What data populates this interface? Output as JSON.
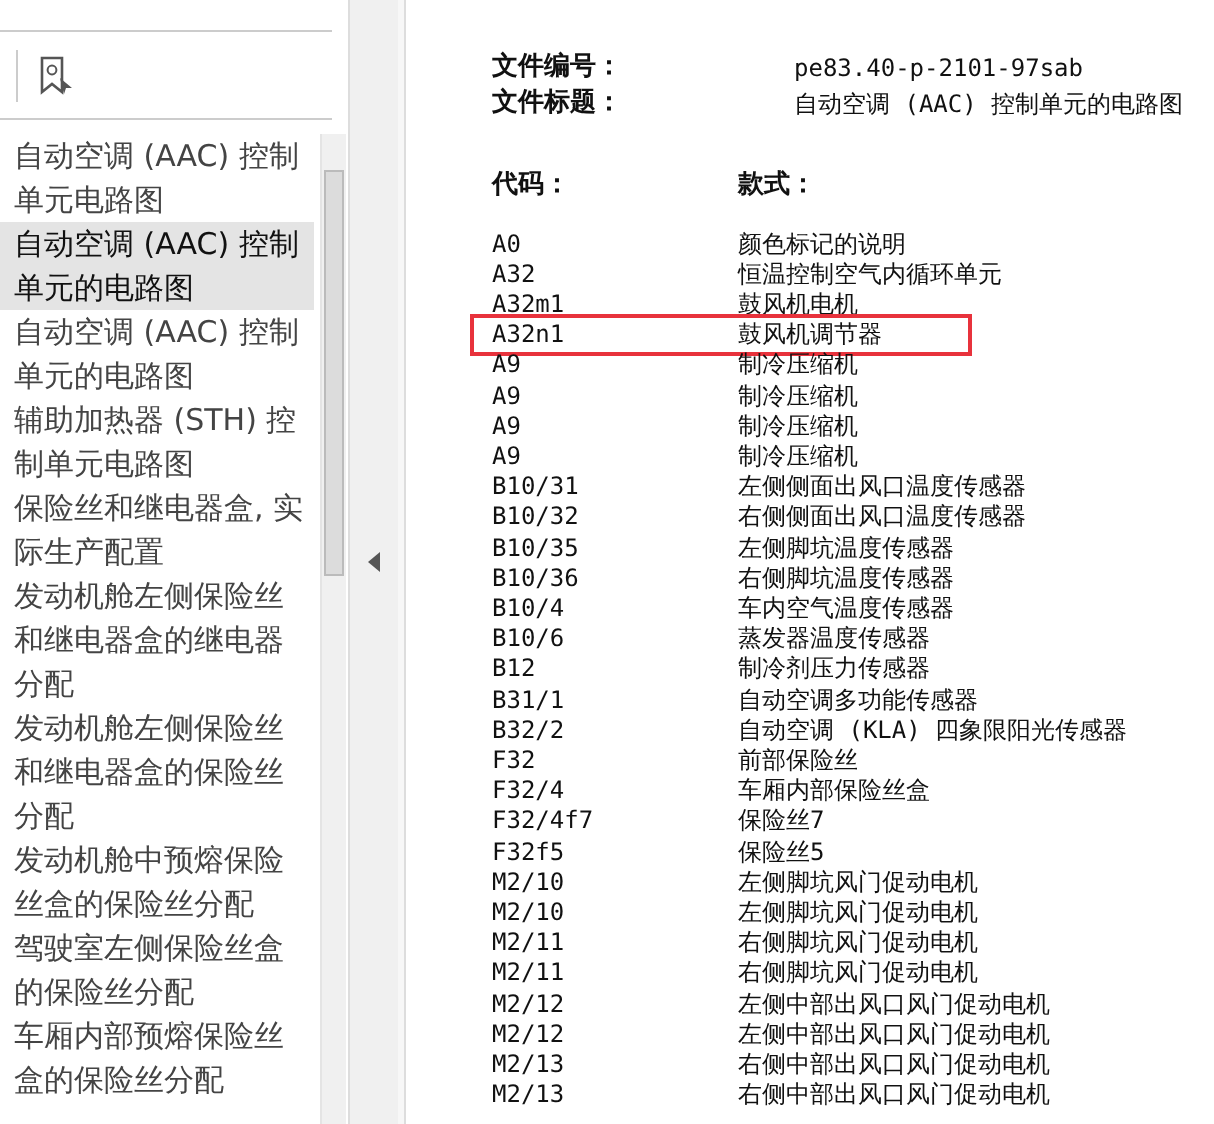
{
  "sidebar": {
    "items": [
      {
        "label": "自动空调 (AAC) 控制单元电路图",
        "selected": false
      },
      {
        "label": "自动空调 (AAC) 控制单元的电路图",
        "selected": true
      },
      {
        "label": "自动空调 (AAC) 控制单元的电路图",
        "selected": false
      },
      {
        "label": "辅助加热器 (STH) 控制单元电路图",
        "selected": false
      },
      {
        "label": "保险丝和继电器盒, 实际生产配置",
        "selected": false
      },
      {
        "label": "发动机舱左侧保险丝和继电器盒的继电器分配",
        "selected": false
      },
      {
        "label": "发动机舱左侧保险丝和继电器盒的保险丝分配",
        "selected": false
      },
      {
        "label": "发动机舱中预熔保险丝盒的保险丝分配",
        "selected": false
      },
      {
        "label": "驾驶室左侧保险丝盒的保险丝分配",
        "selected": false
      },
      {
        "label": "车厢内部预熔保险丝盒的保险丝分配",
        "selected": false
      }
    ]
  },
  "document": {
    "fields": [
      {
        "label": "文件编号：",
        "value": "pe83.40-p-2101-97sab"
      },
      {
        "label": "文件标题：",
        "value": "自动空调 (AAC) 控制单元的电路图"
      }
    ],
    "columns": [
      "代码：",
      "款式："
    ],
    "rows": [
      {
        "code": "A0",
        "name": "颜色标记的说明",
        "highlighted": false
      },
      {
        "code": "A32",
        "name": "恒温控制空气内循环单元",
        "highlighted": false
      },
      {
        "code": "A32m1",
        "name": "鼓风机电机",
        "highlighted": false
      },
      {
        "code": "A32n1",
        "name": "鼓风机调节器",
        "highlighted": true
      },
      {
        "code": "A9",
        "name": "制冷压缩机",
        "highlighted": false
      },
      {
        "code": "A9",
        "name": "制冷压缩机",
        "highlighted": false
      },
      {
        "code": "A9",
        "name": "制冷压缩机",
        "highlighted": false
      },
      {
        "code": "A9",
        "name": "制冷压缩机",
        "highlighted": false
      },
      {
        "code": "B10/31",
        "name": "左侧侧面出风口温度传感器",
        "highlighted": false
      },
      {
        "code": "B10/32",
        "name": "右侧侧面出风口温度传感器",
        "highlighted": false
      },
      {
        "code": "B10/35",
        "name": "左侧脚坑温度传感器",
        "highlighted": false
      },
      {
        "code": "B10/36",
        "name": "右侧脚坑温度传感器",
        "highlighted": false
      },
      {
        "code": "B10/4",
        "name": "车内空气温度传感器",
        "highlighted": false
      },
      {
        "code": "B10/6",
        "name": "蒸发器温度传感器",
        "highlighted": false
      },
      {
        "code": "B12",
        "name": "制冷剂压力传感器",
        "highlighted": false
      },
      {
        "code": "B31/1",
        "name": "自动空调多功能传感器",
        "highlighted": false
      },
      {
        "code": "B32/2",
        "name": "自动空调 (KLA) 四象限阳光传感器",
        "highlighted": false
      },
      {
        "code": "F32",
        "name": "前部保险丝",
        "highlighted": false
      },
      {
        "code": "F32/4",
        "name": "车厢内部保险丝盒",
        "highlighted": false
      },
      {
        "code": "F32/4f7",
        "name": "保险丝7",
        "highlighted": false
      },
      {
        "code": "F32f5",
        "name": "保险丝5",
        "highlighted": false
      },
      {
        "code": "M2/10",
        "name": "左侧脚坑风门促动电机",
        "highlighted": false
      },
      {
        "code": "M2/10",
        "name": "左侧脚坑风门促动电机",
        "highlighted": false
      },
      {
        "code": "M2/11",
        "name": "右侧脚坑风门促动电机",
        "highlighted": false
      },
      {
        "code": "M2/11",
        "name": "右侧脚坑风门促动电机",
        "highlighted": false
      },
      {
        "code": "M2/12",
        "name": "左侧中部出风口风门促动电机",
        "highlighted": false
      },
      {
        "code": "M2/12",
        "name": "左侧中部出风口风门促动电机",
        "highlighted": false
      },
      {
        "code": "M2/13",
        "name": "右侧中部出风口风门促动电机",
        "highlighted": false
      },
      {
        "code": "M2/13",
        "name": "右侧中部出风口风门促动电机",
        "highlighted": false
      }
    ]
  }
}
